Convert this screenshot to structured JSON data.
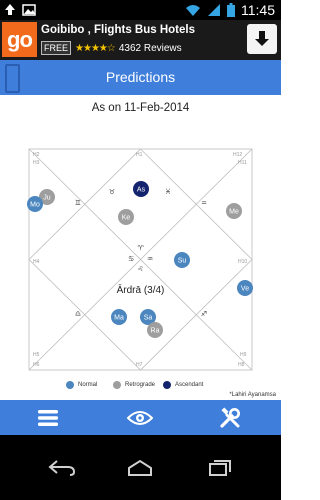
{
  "status_bar": {
    "time": "11:45",
    "icons": [
      "upload-icon",
      "image-icon",
      "wifi-icon",
      "signal-icon",
      "battery-icon"
    ]
  },
  "ad": {
    "logo_text": "go",
    "title": "Goibibo , Flights Bus Hotels",
    "free_label": "FREE",
    "stars": "★★★★☆",
    "rating": 4,
    "reviews": "4362 Reviews",
    "download_icon": "download-icon"
  },
  "header": {
    "title": "Predictions"
  },
  "as_on": "As on 11-Feb-2014",
  "chart": {
    "houses": [
      "H1",
      "H2",
      "H3",
      "H4",
      "H5",
      "H6",
      "H7",
      "H8",
      "H9",
      "H10",
      "H11",
      "H12"
    ],
    "signs": {
      "h1": "♉",
      "h3": "♊",
      "h12": "♓",
      "h11": "=",
      "center_top": "♈",
      "center_left": "♋",
      "center_right": "♒",
      "center_bottom": "♌",
      "h5_sign": "♎",
      "h8_sign": "♐"
    },
    "nakshatra": "Ārdrā (3/4)",
    "planets": [
      {
        "label": "As",
        "status": "ascendant"
      },
      {
        "label": "Ke",
        "status": "retrograde"
      },
      {
        "label": "Ju",
        "status": "retrograde"
      },
      {
        "label": "Mo",
        "status": "normal"
      },
      {
        "label": "Me",
        "status": "retrograde"
      },
      {
        "label": "Su",
        "status": "normal"
      },
      {
        "label": "Ve",
        "status": "normal"
      },
      {
        "label": "Ma",
        "status": "normal"
      },
      {
        "label": "Sa",
        "status": "normal"
      },
      {
        "label": "Ra",
        "status": "retrograde"
      }
    ]
  },
  "legend": {
    "normal": "Normal",
    "retrograde": "Retrograde",
    "ascendant": "Ascendant"
  },
  "colors": {
    "normal": "#4b86bf",
    "retrograde": "#9e9e9e",
    "ascendant": "#14236e",
    "header": "#3f7fdb",
    "lines": "#bdbdbd"
  },
  "ayanamsa": "*Lahiri Ayanamsa",
  "bottom_nav": [
    "menu-icon",
    "eye-icon",
    "tools-icon"
  ],
  "system_nav": [
    "back-icon",
    "home-icon",
    "recents-icon"
  ]
}
